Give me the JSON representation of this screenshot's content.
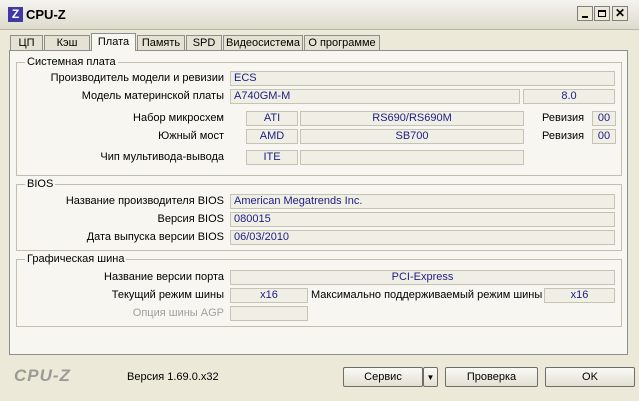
{
  "window": {
    "title": "CPU-Z",
    "logo_letter": "Z"
  },
  "tabs": [
    "ЦП",
    "Кэш",
    "Плата",
    "Память",
    "SPD",
    "Видеосистема",
    "О программе"
  ],
  "active_tab": "Плата",
  "motherboard": {
    "group_title": "Системная плата",
    "manufacturer_label": "Производитель модели и ревизии",
    "manufacturer_value": "ECS",
    "model_label": "Модель материнской платы",
    "model_value": "A740GM-M",
    "model_revision": "8.0",
    "chipset_label": "Набор микросхем",
    "chipset_vendor": "ATI",
    "chipset_model": "RS690/RS690M",
    "revision_label": "Ревизия",
    "chipset_revision": "00",
    "southbridge_label": "Южный мост",
    "southbridge_vendor": "AMD",
    "southbridge_model": "SB700",
    "southbridge_revision": "00",
    "lpcio_label": "Чип мультивода-вывода",
    "lpcio_vendor": "ITE",
    "lpcio_model": ""
  },
  "bios": {
    "group_title": "BIOS",
    "brand_label": "Название производителя BIOS",
    "brand_value": "American Megatrends Inc.",
    "version_label": "Версия BIOS",
    "version_value": "080015",
    "date_label": "Дата выпуска версии BIOS",
    "date_value": "06/03/2010"
  },
  "graphic_interface": {
    "group_title": "Графическая шина",
    "port_label": "Название версии порта",
    "port_value": "PCI-Express",
    "link_width_label": "Текущий режим шины",
    "link_width_value": "x16",
    "max_supported_label": "Максимально поддерживаемый режим шины",
    "max_supported_value": "x16",
    "agp_label": "Опция шины AGP",
    "agp_value": ""
  },
  "footer": {
    "brand": "CPU-Z",
    "version": "Версия 1.69.0.x32",
    "tools_button": "Сервис",
    "validate_button": "Проверка",
    "ok_button": "OK"
  }
}
